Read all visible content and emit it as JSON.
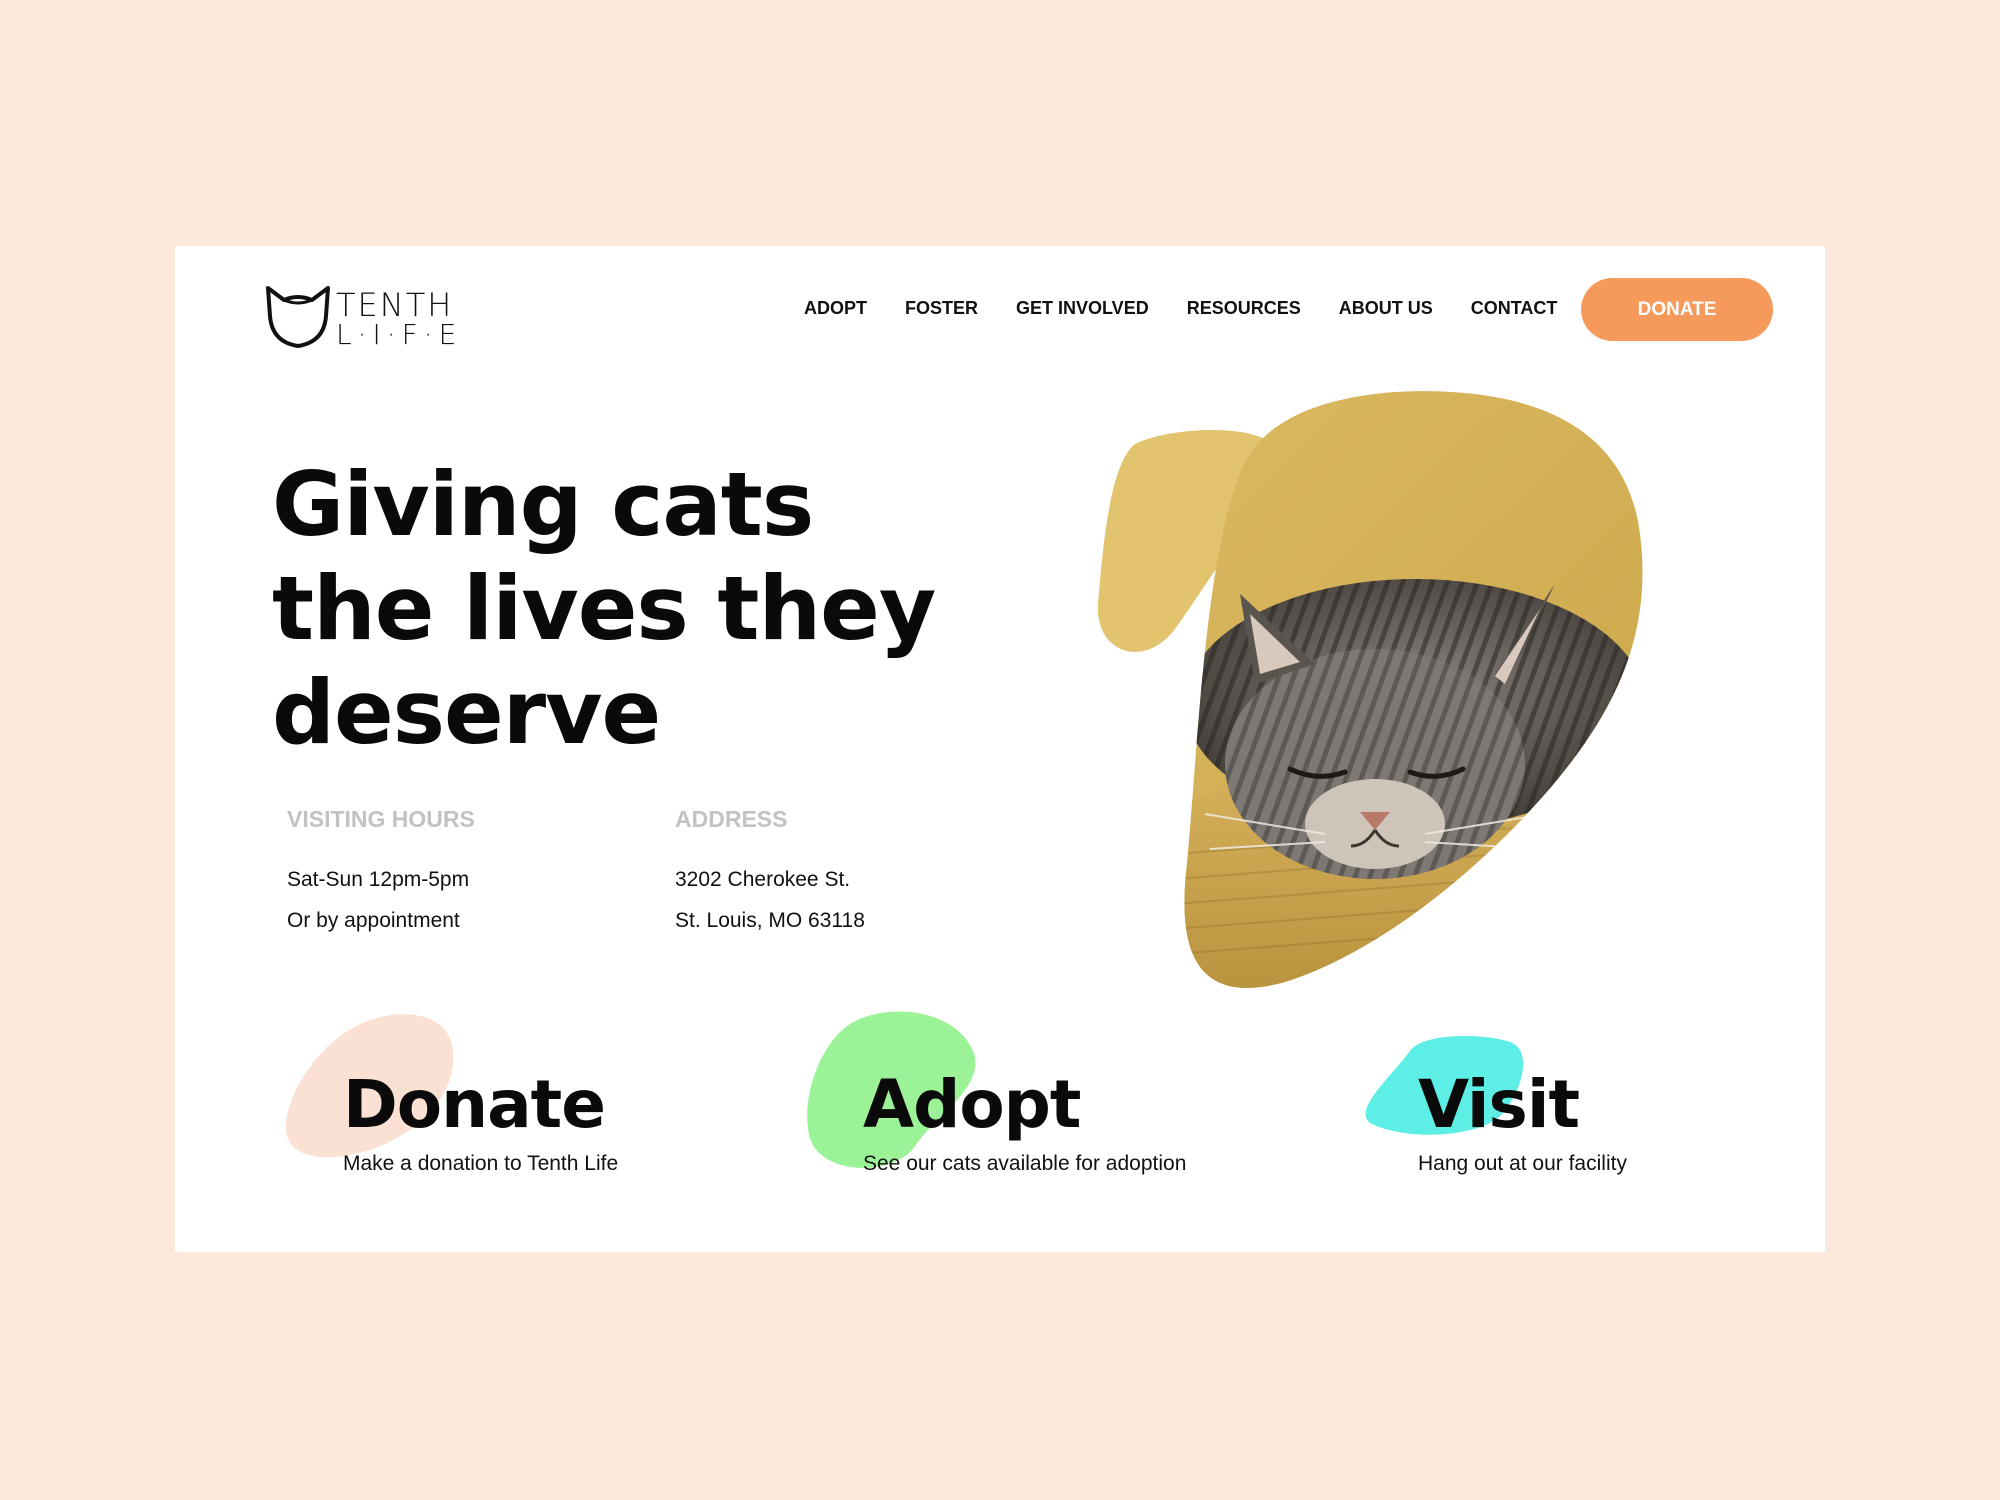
{
  "brand": {
    "name_top": "TENTH",
    "name_bottom": "L·I·F·E"
  },
  "nav": {
    "items": [
      "ADOPT",
      "FOSTER",
      "GET INVOLVED",
      "RESOURCES",
      "ABOUT US",
      "CONTACT"
    ],
    "donate_label": "DONATE"
  },
  "hero": {
    "title_lines": [
      "Giving cats",
      "the lives they",
      "deserve"
    ],
    "hours": {
      "label": "VISITING HOURS",
      "lines": [
        "Sat-Sun 12pm-5pm",
        "Or by appointment"
      ]
    },
    "address": {
      "label": "ADDRESS",
      "lines": [
        "3202 Cherokee St.",
        "St. Louis, MO 63118"
      ]
    },
    "image_subject": "sleeping tabby cat on mustard cushion"
  },
  "features": [
    {
      "title": "Donate",
      "subtitle": "Make a donation to Tenth Life",
      "blob_color": "#fbe1d4"
    },
    {
      "title": "Adopt",
      "subtitle": "See our cats available for adoption",
      "blob_color": "#9cf297"
    },
    {
      "title": "Visit",
      "subtitle": "Hang out at our facility",
      "blob_color": "#5deee6"
    }
  ],
  "colors": {
    "page_background": "#fce9dc",
    "accent": "#f59a5b",
    "hero_blob": "#e2c36e",
    "label_gray": "#c2c2c2"
  }
}
